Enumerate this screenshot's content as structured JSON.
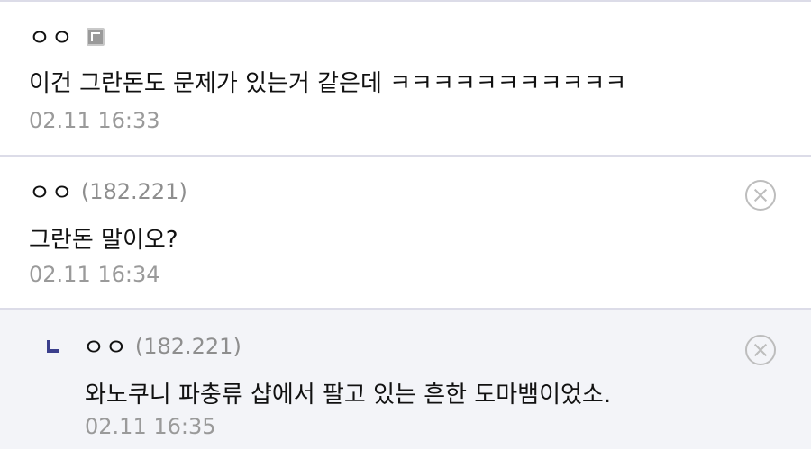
{
  "comments": [
    {
      "nickname": "ㅇㅇ",
      "ip": "",
      "gallog_icon": "gallog-icon",
      "text": "이건 그란돈도 문제가 있는거 같은데 ㅋㅋㅋㅋㅋㅋㅋㅋㅋㅋㅋ",
      "date": "02.11 16:33",
      "is_reply": false,
      "has_delete": false
    },
    {
      "nickname": "ㅇㅇ",
      "ip": "(182.221)",
      "text": "그란돈 말이오?",
      "date": "02.11 16:34",
      "is_reply": false,
      "has_delete": true,
      "delete_icon": "close-circle-icon"
    },
    {
      "nickname": "ㅇㅇ",
      "ip": "(182.221)",
      "text": "와노쿠니 파충류 샵에서 팔고 있는 흔한 도마뱀이었소.",
      "date": "02.11 16:35",
      "is_reply": true,
      "reply_icon": "reply-arrow-icon",
      "has_delete": true,
      "delete_icon": "close-circle-icon"
    }
  ],
  "colors": {
    "reply_background": "#f3f4f8",
    "separator": "#dcdce8",
    "reply_mark": "#3b3f8c",
    "timestamp": "#9a9a9a",
    "ip": "#8e8e8e"
  }
}
